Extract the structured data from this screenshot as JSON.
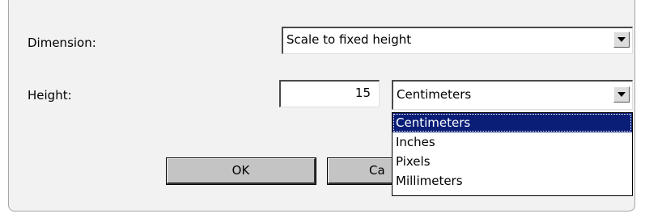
{
  "dimension": {
    "label": "Dimension:",
    "selected": "Scale to fixed height"
  },
  "height": {
    "label": "Height:",
    "value": "15",
    "unit_selected": "Centimeters"
  },
  "unit_dropdown": {
    "options": [
      "Centimeters",
      "Inches",
      "Pixels",
      "Millimeters"
    ],
    "highlighted": "Centimeters"
  },
  "buttons": {
    "ok_label": "OK",
    "cancel_label_visible": "Ca"
  },
  "icons": {
    "dropdown_arrow": "chevron-down-icon"
  }
}
